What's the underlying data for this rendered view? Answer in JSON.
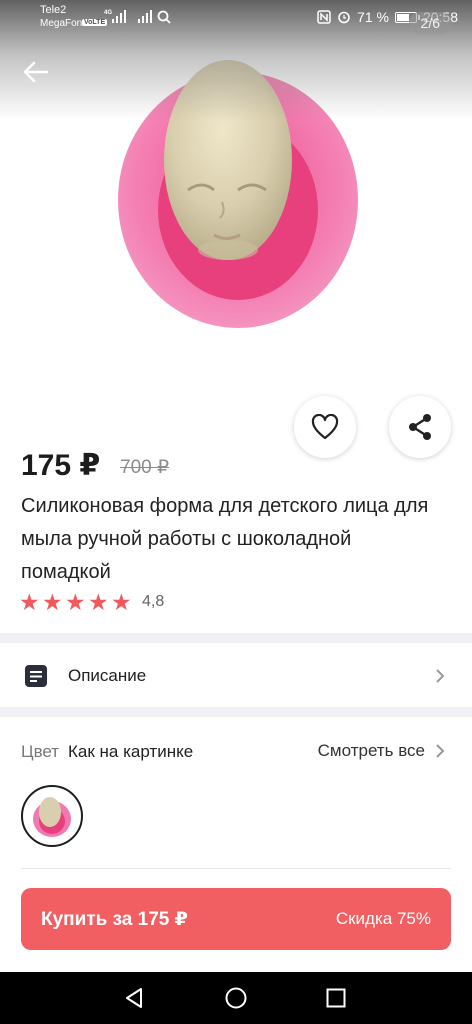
{
  "status_bar": {
    "carrier_1": "Tele2",
    "carrier_2": "MegaFon",
    "volte": "VoLTE",
    "network": "4G",
    "battery_text": "71 %",
    "battery_level": 0.71,
    "time": "20:58"
  },
  "gallery": {
    "counter": "2/6"
  },
  "product": {
    "price": "175 ₽",
    "old_price": "700 ₽",
    "title": "Силиконовая форма для детского лица для мыла ручной работы с шоколадной помадкой",
    "rating": "4,8",
    "rating_stars": 5
  },
  "description_row": {
    "label": "Описание"
  },
  "color_row": {
    "label": "Цвет",
    "value": "Как на картинке",
    "see_all": "Смотреть все"
  },
  "buy_button": {
    "label": "Купить за 175 ₽",
    "discount": "Скидка 75%"
  },
  "colors": {
    "accent": "#f25f62",
    "star": "#f05a5e",
    "mold_pink": "#f07ab0"
  }
}
